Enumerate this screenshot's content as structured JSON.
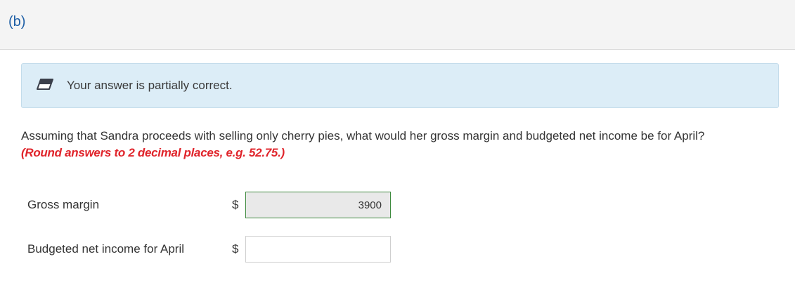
{
  "part": {
    "label": "(b)"
  },
  "feedback": {
    "icon": "partial-credit-icon",
    "message": "Your answer is partially correct.",
    "background_color": "#dcedf7"
  },
  "question": {
    "text": "Assuming that Sandra proceeds with selling only cherry pies, what would her gross margin and budgeted net income be for April?",
    "instruction": "(Round answers to 2 decimal places, e.g. 52.75.)",
    "instruction_color": "#e0242b"
  },
  "answers": [
    {
      "label": "Gross margin",
      "currency": "$",
      "value": "3900",
      "status": "correct"
    },
    {
      "label": "Budgeted net income for April",
      "currency": "$",
      "value": "",
      "status": "empty"
    }
  ]
}
